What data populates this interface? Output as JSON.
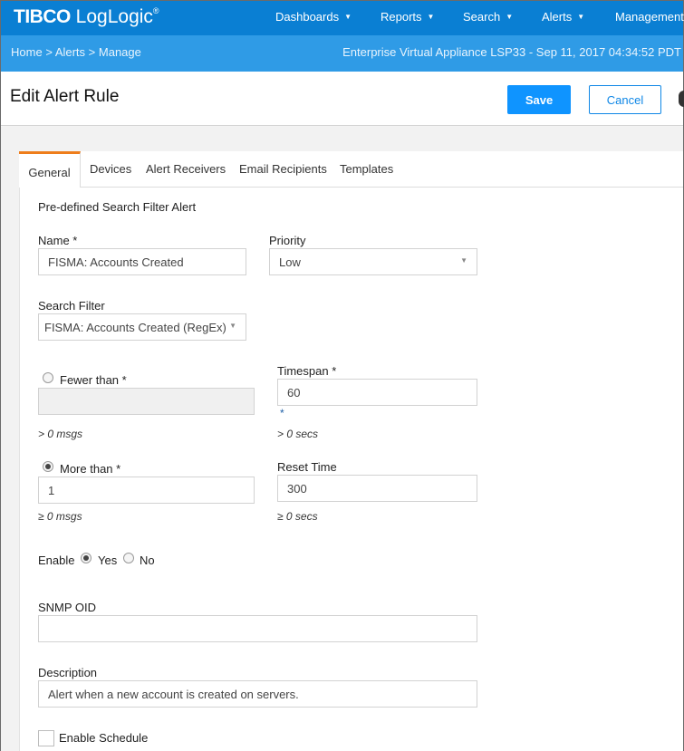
{
  "brand": {
    "tibco": "TIBC",
    "o_glyph": "O",
    "product": " LogLogic",
    "reg": "®"
  },
  "nav": {
    "items": [
      {
        "label": "Dashboards",
        "caret": "▼"
      },
      {
        "label": "Reports",
        "caret": "▼"
      },
      {
        "label": "Search",
        "caret": "▼"
      },
      {
        "label": "Alerts",
        "caret": "▼"
      },
      {
        "label": "Management"
      }
    ]
  },
  "breadcrumb": {
    "home": "Home",
    "sep": ">",
    "alerts": "Alerts",
    "manage": "Manage"
  },
  "appliance": "Enterprise Virtual Appliance LSP33 - Sep 11, 2017 04:34:52 PDT",
  "header": {
    "title": "Edit Alert Rule",
    "save_label": "Save",
    "cancel_label": "Cancel"
  },
  "tabs": [
    {
      "label": "General",
      "active": true
    },
    {
      "label": "Devices"
    },
    {
      "label": "Alert Receivers"
    },
    {
      "label": "Email Recipients"
    },
    {
      "label": "Templates"
    }
  ],
  "form": {
    "section_title": "Pre-defined Search Filter Alert",
    "name": {
      "label": "Name *",
      "value": "FISMA: Accounts Created"
    },
    "priority": {
      "label": "Priority",
      "value": "Low"
    },
    "search_filter": {
      "label": "Search Filter",
      "value": "FISMA: Accounts Created (RegEx)"
    },
    "fewer_than": {
      "label": "Fewer than *",
      "value": "",
      "hint": "> 0 msgs",
      "checked": false
    },
    "timespan": {
      "label": "Timespan *",
      "value": "60",
      "marker": "*",
      "hint": "> 0 secs"
    },
    "more_than": {
      "label": "More than *",
      "value": "1",
      "hint": "≥ 0 msgs",
      "checked": true
    },
    "reset_time": {
      "label": "Reset Time",
      "value": "300",
      "hint": "≥ 0 secs"
    },
    "enable": {
      "label": "Enable",
      "yes_label": "Yes",
      "no_label": "No",
      "selected": "Yes"
    },
    "snmp_oid": {
      "label": "SNMP OID",
      "value": ""
    },
    "description": {
      "label": "Description",
      "value": "Alert when a new account is created on servers."
    },
    "enable_schedule": {
      "label": "Enable Schedule",
      "checked": false
    }
  },
  "colors": {
    "nav_bg": "#0a7fd3",
    "subbar_bg": "#2f9be6",
    "save_bg": "#0f94ff",
    "tab_accent": "#ee7d1b"
  }
}
